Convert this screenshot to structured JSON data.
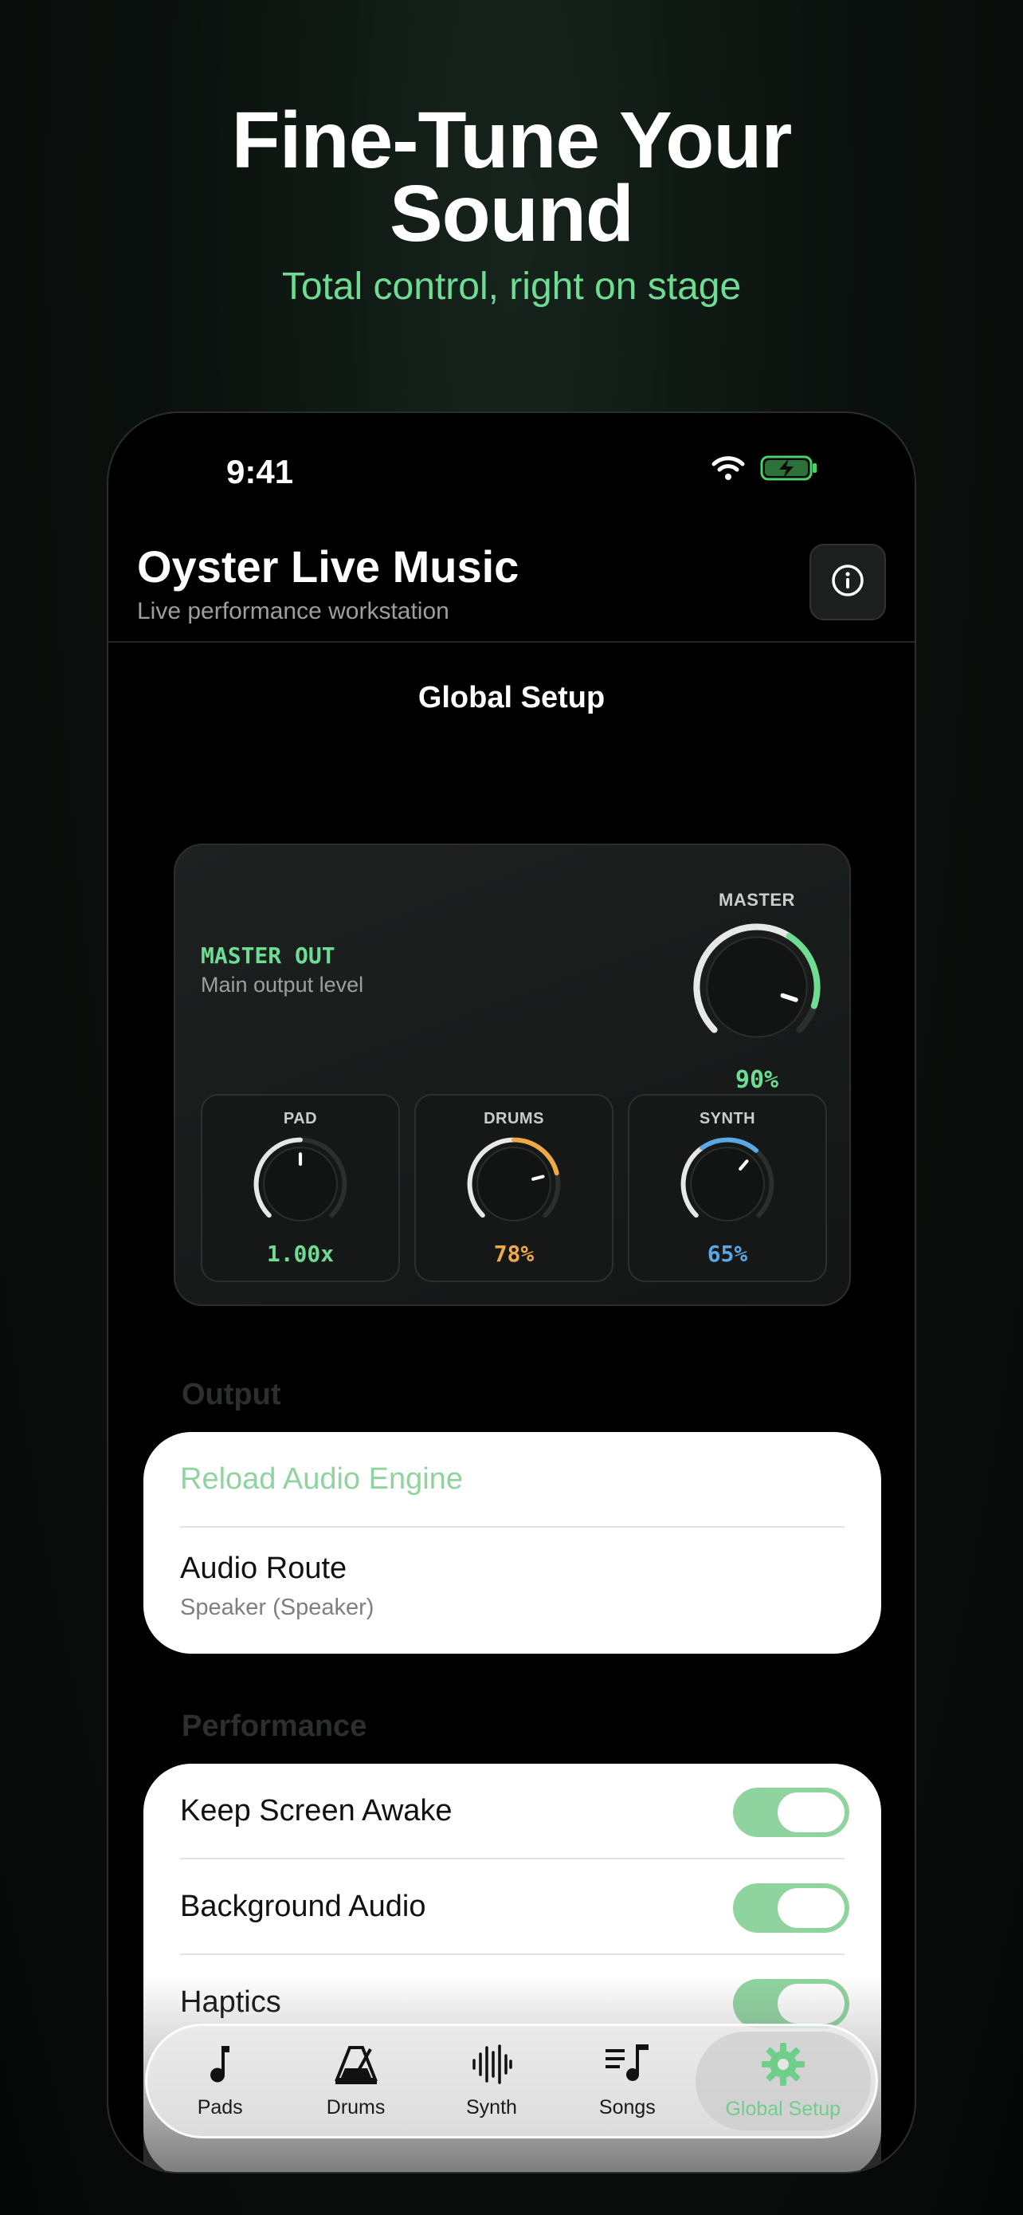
{
  "hero": {
    "headline_line1": "Fine-Tune Your",
    "headline_line2": "Sound",
    "subheadline": "Total control, right on stage"
  },
  "status_bar": {
    "time": "9:41",
    "icons": [
      "wifi-icon",
      "battery-charging-icon"
    ]
  },
  "header": {
    "title": "Oyster Live Music",
    "subtitle": "Live performance workstation",
    "info_icon": "info-icon"
  },
  "nav": {
    "title": "Global Setup"
  },
  "mixer": {
    "label": "MASTER OUT",
    "description": "Main output level",
    "master": {
      "caption": "MASTER",
      "value_text": "90%",
      "level": 0.9,
      "color": "#6fdc94"
    },
    "channels": [
      {
        "caption": "PAD",
        "value_text": "1.00x",
        "level": 0.5,
        "color": "#e6e6e6",
        "value_color": "#6fdc94"
      },
      {
        "caption": "DRUMS",
        "value_text": "78%",
        "level": 0.78,
        "color": "#f0a947",
        "value_color": "#f0a947"
      },
      {
        "caption": "SYNTH",
        "value_text": "65%",
        "level": 0.65,
        "color": "#5aa8e6",
        "value_color": "#5aa8e6"
      }
    ]
  },
  "output_section": {
    "header": "Output",
    "reload_label": "Reload Audio Engine",
    "route_label": "Audio Route",
    "route_value": "Speaker (Speaker)"
  },
  "performance_section": {
    "header": "Performance",
    "rows": [
      {
        "label": "Keep Screen Awake",
        "on": true
      },
      {
        "label": "Background Audio",
        "on": true
      },
      {
        "label": "Haptics",
        "on": true
      }
    ]
  },
  "tabbar": {
    "tabs": [
      {
        "label": "Pads",
        "icon": "music-note-icon"
      },
      {
        "label": "Drums",
        "icon": "metronome-icon"
      },
      {
        "label": "Synth",
        "icon": "waveform-icon"
      },
      {
        "label": "Songs",
        "icon": "music-list-icon"
      },
      {
        "label": "Global Setup",
        "icon": "gear-icon",
        "active": true
      }
    ]
  },
  "colors": {
    "accent": "#6fdc94",
    "toggle_on": "#8fd49f"
  }
}
